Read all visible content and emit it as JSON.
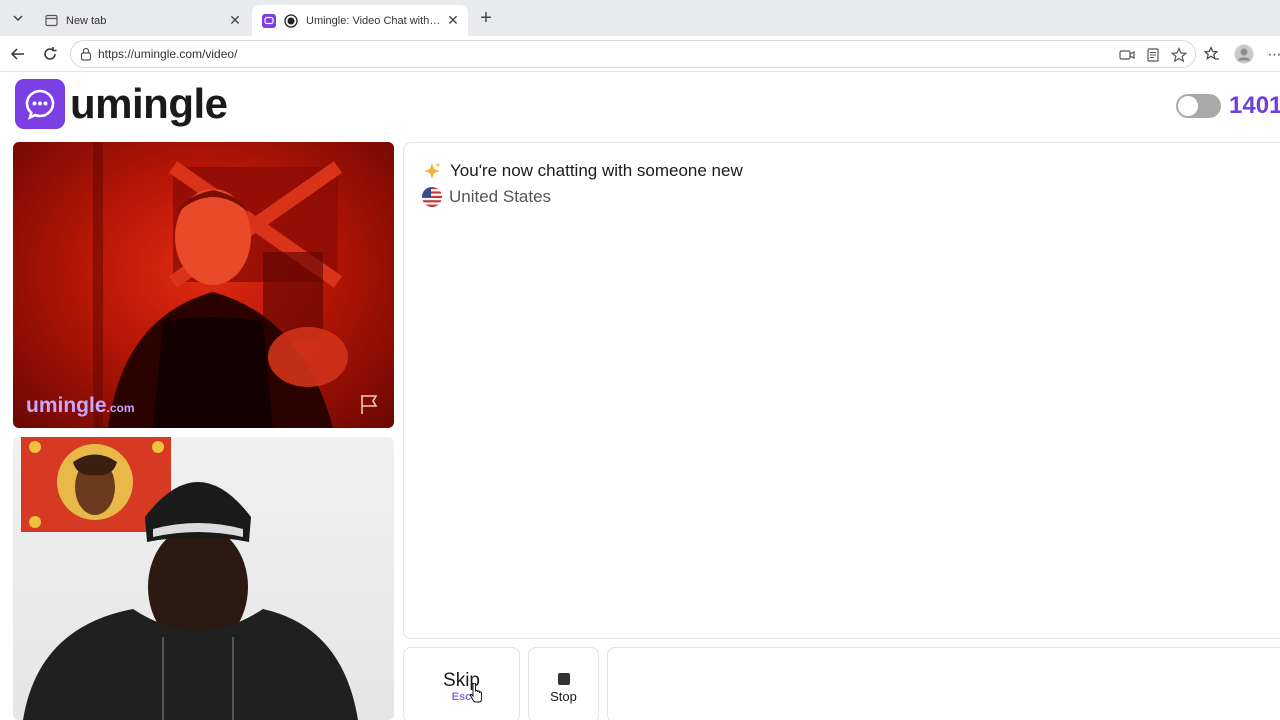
{
  "browser": {
    "tabs": [
      {
        "title": "New tab",
        "active": false
      },
      {
        "title": "Umingle: Video Chat with Stra",
        "active": true
      }
    ],
    "url": "https://umingle.com/video/"
  },
  "site": {
    "logo_text": "umingle",
    "online_count": "1401",
    "brand_color": "#7b3fe4"
  },
  "remote_video": {
    "watermark": "umingle",
    "watermark_suffix": ".com"
  },
  "chat": {
    "status_message": "You're now chatting with someone new",
    "country": "United States"
  },
  "controls": {
    "skip_label": "Skip",
    "skip_hint": "Esc",
    "stop_label": "Stop"
  }
}
